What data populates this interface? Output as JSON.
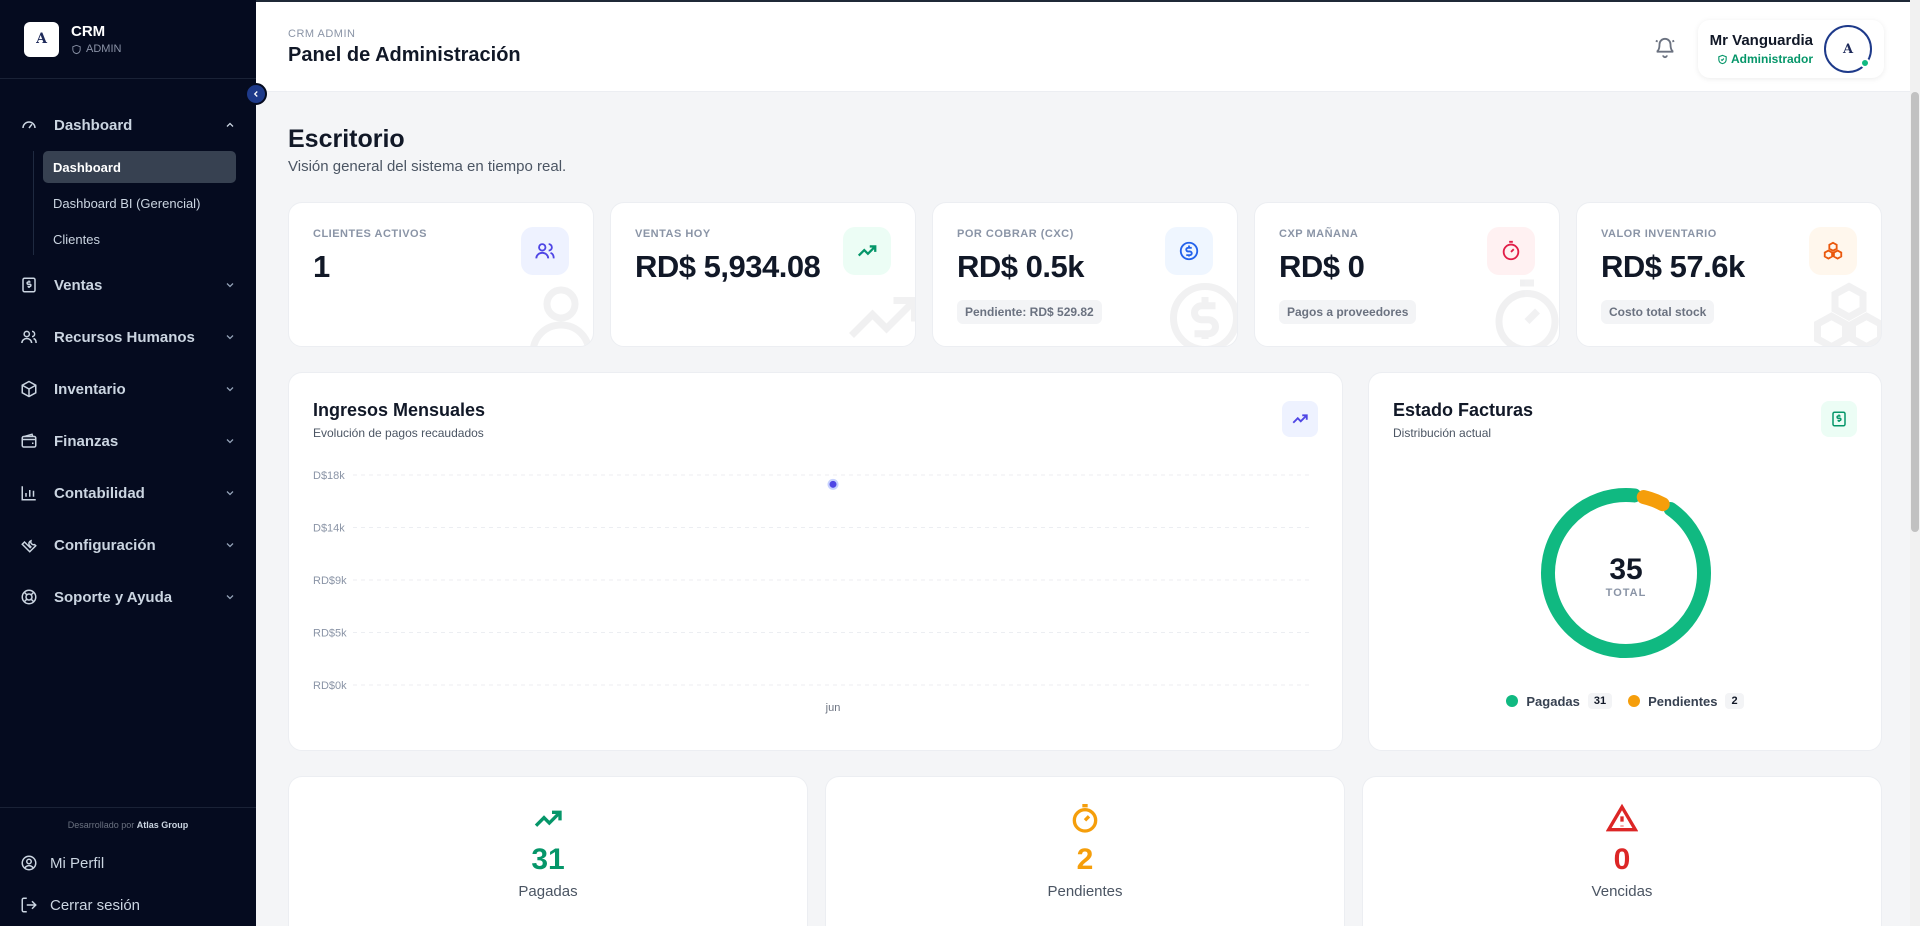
{
  "brand": {
    "logo_text": "A",
    "title": "CRM",
    "subtitle": "ADMIN"
  },
  "sidebar": {
    "items": [
      {
        "label": "Dashboard",
        "icon": "gauge-icon",
        "expanded": true
      },
      {
        "label": "Ventas",
        "icon": "dollar-receipt-icon"
      },
      {
        "label": "Recursos Humanos",
        "icon": "users-icon"
      },
      {
        "label": "Inventario",
        "icon": "package-icon"
      },
      {
        "label": "Finanzas",
        "icon": "wallet-icon"
      },
      {
        "label": "Contabilidad",
        "icon": "bar-chart-icon"
      },
      {
        "label": "Configuración",
        "icon": "wrench-icon"
      },
      {
        "label": "Soporte y Ayuda",
        "icon": "lifebuoy-icon"
      }
    ],
    "dashboard_sub": [
      {
        "label": "Dashboard",
        "active": true
      },
      {
        "label": "Dashboard BI (Gerencial)"
      },
      {
        "label": "Clientes"
      }
    ],
    "footer": {
      "dev_prefix": "Desarrollado por",
      "dev_name": "Atlas Group",
      "profile_label": "Mi Perfil",
      "logout_label": "Cerrar sesión"
    }
  },
  "header": {
    "crumb": "CRM ADMIN",
    "title": "Panel de Administración",
    "user_name": "Mr Vanguardia",
    "user_role": "Administrador"
  },
  "main": {
    "title": "Escritorio",
    "subtitle": "Visión general del sistema en tiempo real.",
    "kpis": [
      {
        "label": "CLIENTES ACTIVOS",
        "value": "1",
        "chip": "",
        "icon": "users-icon",
        "color": "#4f46e5",
        "bg": "#eef2ff"
      },
      {
        "label": "VENTAS HOY",
        "value": "RD$ 5,934.08",
        "chip": "",
        "icon": "trending-up-icon",
        "color": "#059669",
        "bg": "#ecfdf5"
      },
      {
        "label": "POR COBRAR (CXC)",
        "value": "RD$ 0.5k",
        "chip": "Pendiente: RD$ 529.82",
        "icon": "dollar-circle-icon",
        "color": "#2563eb",
        "bg": "#eff6ff"
      },
      {
        "label": "CXP MAÑANA",
        "value": "RD$ 0",
        "chip": "Pagos a proveedores",
        "icon": "timer-icon",
        "color": "#e11d48",
        "bg": "#fff1f2"
      },
      {
        "label": "VALOR INVENTARIO",
        "value": "RD$ 57.6k",
        "chip": "Costo total stock",
        "icon": "boxes-icon",
        "color": "#ea580c",
        "bg": "#fff7ed"
      }
    ],
    "income_panel": {
      "title": "Ingresos Mensuales",
      "subtitle": "Evolución de pagos recaudados"
    },
    "invoice_panel": {
      "title": "Estado Facturas",
      "subtitle": "Distribución actual",
      "total": "35",
      "total_label": "TOTAL"
    },
    "stats": [
      {
        "value": "31",
        "label": "Pagadas",
        "color": "#059669",
        "icon": "trending-up-icon"
      },
      {
        "value": "2",
        "label": "Pendientes",
        "color": "#f59e0b",
        "icon": "timer-icon"
      },
      {
        "value": "0",
        "label": "Vencidas",
        "color": "#dc2626",
        "icon": "alert-triangle-icon"
      }
    ]
  },
  "chart_data": [
    {
      "type": "line",
      "x": [
        "jun"
      ],
      "series": [
        {
          "values": [
            17200
          ],
          "color": "#4f46e5"
        }
      ],
      "yticks": [
        "D$18k",
        "D$14k",
        "RD$9k",
        "RD$5k",
        "RD$0k"
      ],
      "ylim": [
        0,
        18000
      ],
      "grid": true
    },
    {
      "type": "pie",
      "categories": [
        "Pagadas",
        "Pendientes"
      ],
      "values": [
        31,
        2
      ],
      "colors": [
        "#10b981",
        "#f59e0b"
      ],
      "total": 35
    }
  ]
}
